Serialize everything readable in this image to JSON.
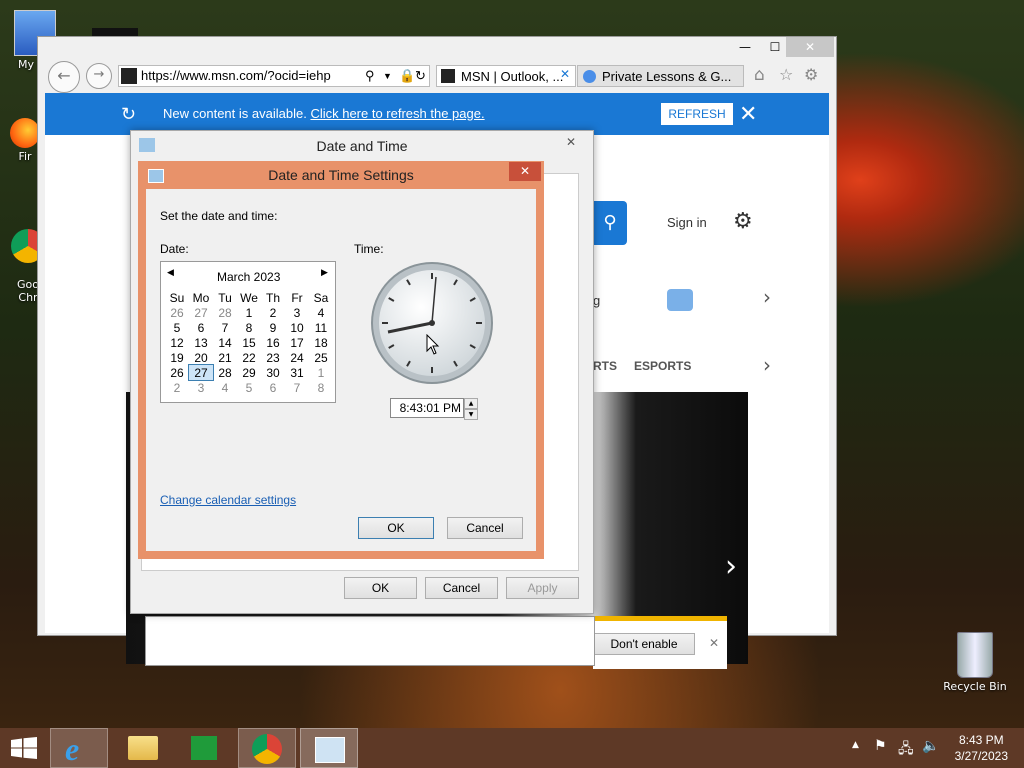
{
  "desktop": {
    "icons": [
      {
        "label": "My Co"
      },
      {
        "label": "Fir"
      },
      {
        "label": "Goo\nChr"
      },
      {
        "label": "Recycle Bin"
      }
    ]
  },
  "ie": {
    "address": "https://www.msn.com/?ocid=iehp",
    "tabs": [
      {
        "label": "MSN | Outlook, ..."
      },
      {
        "label": "Private Lessons & G..."
      }
    ],
    "notice": {
      "text": "New content is available.",
      "link": "Click here to refresh the page.",
      "refresh_button": "REFRESH"
    },
    "page": {
      "signin": "Sign in",
      "nav_rts": "RTS",
      "nav_esports": "ESPORTS",
      "g_text": "g",
      "dont_enable": "Don't enable"
    }
  },
  "date_time": {
    "title": "Date and Time",
    "ok": "OK",
    "cancel": "Cancel",
    "apply": "Apply"
  },
  "dts": {
    "title": "Date and Time Settings",
    "instruction": "Set the date and time:",
    "date_label": "Date:",
    "time_label": "Time:",
    "month": "March 2023",
    "weekdays": [
      "Su",
      "Mo",
      "Tu",
      "We",
      "Th",
      "Fr",
      "Sa"
    ],
    "weeks": [
      [
        "26",
        "27",
        "28",
        "1",
        "2",
        "3",
        "4"
      ],
      [
        "5",
        "6",
        "7",
        "8",
        "9",
        "10",
        "11"
      ],
      [
        "12",
        "13",
        "14",
        "15",
        "16",
        "17",
        "18"
      ],
      [
        "19",
        "20",
        "21",
        "22",
        "23",
        "24",
        "25"
      ],
      [
        "26",
        "27",
        "28",
        "29",
        "30",
        "31",
        "1"
      ],
      [
        "2",
        "3",
        "4",
        "5",
        "6",
        "7",
        "8"
      ]
    ],
    "selected_day": "27",
    "time_value": "8:43:01 PM",
    "change_link": "Change calendar settings",
    "ok": "OK",
    "cancel": "Cancel"
  },
  "taskbar": {
    "time": "8:43 PM",
    "date": "3/27/2023"
  }
}
